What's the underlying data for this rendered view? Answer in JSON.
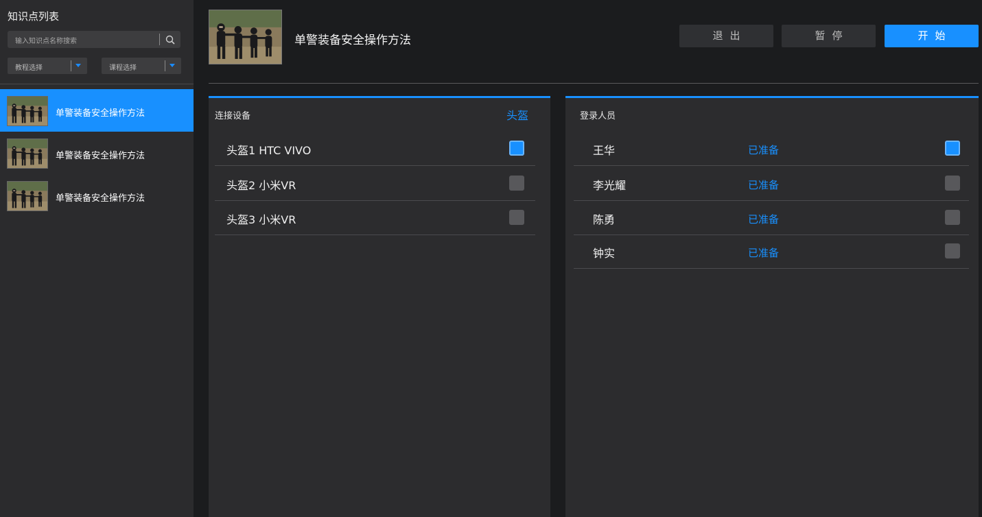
{
  "sidebar": {
    "title": "知识点列表",
    "search": {
      "placeholder": "输入知识点名称搜索",
      "icon": "search-icon"
    },
    "filters": [
      {
        "selected": "教程选择"
      },
      {
        "selected": "课程选择"
      }
    ],
    "items": [
      {
        "label": "单警装备安全操作方法",
        "active": true
      },
      {
        "label": "单警装备安全操作方法",
        "active": false
      },
      {
        "label": "单警装备安全操作方法",
        "active": false
      }
    ]
  },
  "header": {
    "title": "单警装备安全操作方法",
    "buttons": {
      "exit": "退出",
      "pause": "暂停",
      "start": "开始"
    }
  },
  "devices": {
    "title": "连接设备",
    "tag": "头盔",
    "items": [
      {
        "name": "头盔1 HTC VIVO",
        "checked": true
      },
      {
        "name": "头盔2 小米VR",
        "checked": false
      },
      {
        "name": "头盔3 小米VR",
        "checked": false
      }
    ]
  },
  "users": {
    "title": "登录人员",
    "items": [
      {
        "name": "王华",
        "status": "已准备",
        "checked": true
      },
      {
        "name": "李光耀",
        "status": "已准备",
        "checked": false
      },
      {
        "name": "陈勇",
        "status": "已准备",
        "checked": false
      },
      {
        "name": "钟实",
        "status": "已准备",
        "checked": false
      }
    ]
  },
  "colors": {
    "accent": "#1890ff",
    "sidebar_bg": "#2b2b2d",
    "page_bg": "#1b1c1e",
    "panel_bg": "#2c2c2e"
  }
}
